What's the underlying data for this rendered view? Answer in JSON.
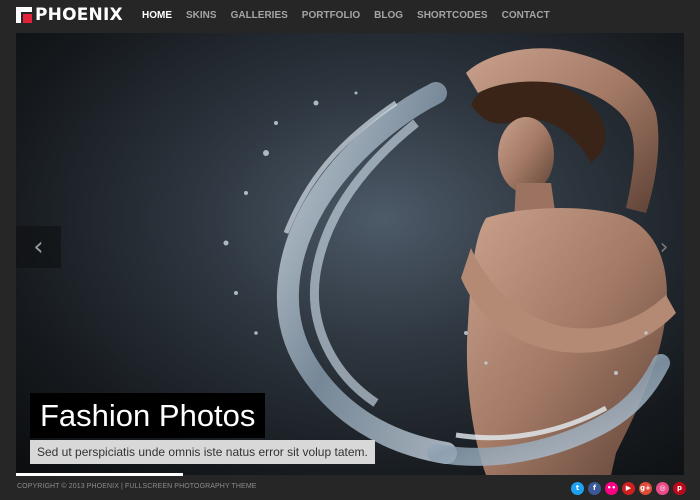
{
  "brand": {
    "name": "PHOENIX"
  },
  "nav": {
    "items": [
      {
        "label": "HOME",
        "active": true
      },
      {
        "label": "SKINS"
      },
      {
        "label": "GALLERIES"
      },
      {
        "label": "PORTFOLIO"
      },
      {
        "label": "BLOG"
      },
      {
        "label": "SHORTCODES"
      },
      {
        "label": "CONTACT"
      }
    ]
  },
  "slider": {
    "title": "Fashion Photos",
    "subtitle": "Sed ut perspiciatis unde omnis iste natus error sit volup tatem.",
    "prev_glyph": "‹",
    "next_glyph": "›",
    "progress": 0.25
  },
  "footer": {
    "copyright": "COPYRIGHT © 2013 PHOENIX | FULLSCREEN PHOTOGRAPHY THEME",
    "social": [
      {
        "icon": "twitter-icon",
        "glyph": "t",
        "color": "#1da1f2"
      },
      {
        "icon": "facebook-icon",
        "glyph": "f",
        "color": "#3b5998"
      },
      {
        "icon": "flickr-icon",
        "glyph": "••",
        "color": "#ff0084"
      },
      {
        "icon": "youtube-icon",
        "glyph": "▶",
        "color": "#cd201f"
      },
      {
        "icon": "google-plus-icon",
        "glyph": "g+",
        "color": "#dd4b39"
      },
      {
        "icon": "dribbble-icon",
        "glyph": "◎",
        "color": "#ea4c89"
      },
      {
        "icon": "pinterest-icon",
        "glyph": "p",
        "color": "#bd081c"
      }
    ]
  },
  "colors": {
    "accent": "#e2213a",
    "background": "#262626",
    "nav_inactive": "#a5a5a5"
  }
}
